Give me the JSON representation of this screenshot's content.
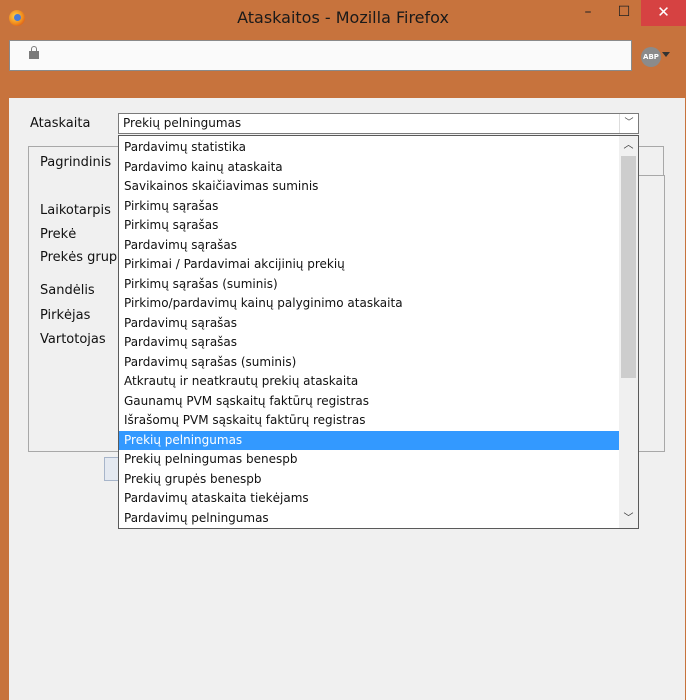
{
  "window": {
    "title": "Ataskaitos - Mozilla Firefox",
    "controls": {
      "minimize": "–",
      "maximize": "☐",
      "close": "✕"
    }
  },
  "toolbar": {
    "abp_label": "ABP"
  },
  "form": {
    "report_label": "Ataskaita",
    "report_selected": "Prekių pelningumas",
    "tab_label": "Pagrindinis",
    "fields": [
      "Laikotarpis",
      "Prekė",
      "Prekės grupė",
      "Sandėlis",
      "Pirkėjas",
      "Vartotojas"
    ]
  },
  "dropdown": {
    "selected_index": 15,
    "options": [
      "Pardavimų statistika",
      "Pardavimo kainų ataskaita",
      "Savikainos skaičiavimas suminis",
      "Pirkimų sąrašas",
      "Pirkimų sąrašas",
      "Pardavimų sąrašas",
      "Pirkimai / Pardavimai akcijinių prekių",
      "Pirkimų sąrašas (suminis)",
      "Pirkimo/pardavimų kainų palyginimo ataskaita",
      "Pardavimų sąrašas",
      "Pardavimų sąrašas",
      "Pardavimų sąrašas (suminis)",
      "Atkrautų ir neatkrautų prekių ataskaita",
      "Gaunamų PVM sąskaitų faktūrų registras",
      "Išrašomų PVM sąskaitų faktūrų registras",
      "Prekių pelningumas",
      "Prekių pelningumas benespb",
      "Prekių grupės benespb",
      "Pardavimų ataskaita tiekėjams",
      "Pardavimų pelningumas"
    ]
  }
}
